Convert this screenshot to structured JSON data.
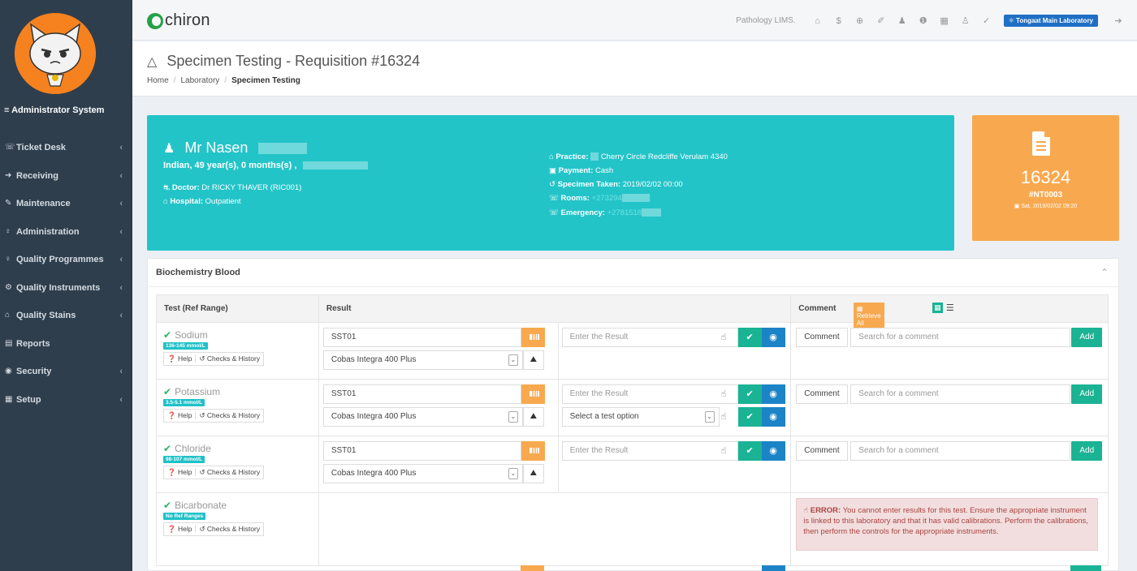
{
  "sidebar": {
    "system_name": "≡ Administrator System",
    "items": [
      {
        "label": "Ticket Desk",
        "icon": "☏",
        "name": "sidebar-item-ticket-desk",
        "icon_name": "phone-icon",
        "chev": true
      },
      {
        "label": "Receiving",
        "icon": "➔",
        "name": "sidebar-item-receiving",
        "icon_name": "arrow-right-icon",
        "chev": true
      },
      {
        "label": "Maintenance",
        "icon": "✎",
        "name": "sidebar-item-maintenance",
        "icon_name": "wrench-icon",
        "chev": true
      },
      {
        "label": "Administration",
        "icon": "♀",
        "name": "sidebar-item-administration",
        "icon_name": "pin-icon",
        "chev": true
      },
      {
        "label": "Quality Programmes",
        "icon": "♀",
        "name": "sidebar-item-quality-programmes",
        "icon_name": "award-icon",
        "chev": true
      },
      {
        "label": "Quality Instruments",
        "icon": "⚙",
        "name": "sidebar-item-quality-instruments",
        "icon_name": "gear-icon",
        "chev": true
      },
      {
        "label": "Quality Stains",
        "icon": "⌂",
        "name": "sidebar-item-quality-stains",
        "icon_name": "stain-icon",
        "chev": true
      },
      {
        "label": "Reports",
        "icon": "▤",
        "name": "sidebar-item-reports",
        "icon_name": "reports-icon",
        "chev": false
      },
      {
        "label": "Security",
        "icon": "◉",
        "name": "sidebar-item-security",
        "icon_name": "eye-icon",
        "chev": true
      },
      {
        "label": "Setup",
        "icon": "▦",
        "name": "sidebar-item-setup",
        "icon_name": "grid-icon",
        "chev": true
      }
    ],
    "chevron": "‹"
  },
  "topbar": {
    "logo_text": "chiron",
    "system_label": "Pathology LIMS.",
    "lab_label": "Tongaat Main Laboratory",
    "icons": [
      "⌂",
      "$",
      "⊕",
      "✐",
      "♟",
      "❶",
      "▦",
      "♙",
      "✓"
    ]
  },
  "page": {
    "title": "Specimen Testing - Requisition #16324",
    "breadcrumb": [
      "Home",
      "Laboratory",
      "Specimen Testing"
    ]
  },
  "patient": {
    "name": "Mr Nasen",
    "info": "Indian, 49 year(s), 0 months(s) ,",
    "doctor_label": "Doctor:",
    "doctor": "Dr RICKY THAVER (RIC001)",
    "hospital_label": "Hospital:",
    "hospital": "Outpatient",
    "practice_label": "Practice:",
    "practice": "Cherry Circle Redcliffe Verulam 4340",
    "payment_label": "Payment:",
    "payment": "Cash",
    "taken_label": "Specimen Taken:",
    "taken": "2019/02/02 00:00",
    "rooms_label": "Rooms:",
    "rooms": "+273294",
    "emergency_label": "Emergency:",
    "emergency": "+2781518"
  },
  "requisition": {
    "number": "16324",
    "code": "#NT0003",
    "date": "Sat, 2019/02/02 09:20"
  },
  "panel": {
    "title": "Biochemistry Blood",
    "headers": {
      "test": "Test (Ref Range)",
      "result": "Result",
      "comment": "Comment"
    },
    "retrieve_label": "Retrieve All Tubes",
    "help_label": "Help",
    "history_label": "Checks & History",
    "result_placeholder": "Enter the Result",
    "comment_label": "Comment",
    "comment_placeholder": "Search for a comment",
    "add_label": "Add",
    "tests": [
      {
        "name": "Sodium",
        "ref": "136-145 mmol/L",
        "tube": "SST01",
        "instrument": "Cobas Integra 400 Plus"
      },
      {
        "name": "Potassium",
        "ref": "3.5-5.1 mmol/L",
        "tube": "SST01",
        "instrument": "Cobas Integra 400 Plus",
        "option_placeholder": "Select a test option"
      },
      {
        "name": "Chloride",
        "ref": "98-107 mmol/L",
        "tube": "SST01",
        "instrument": "Cobas Integra 400 Plus"
      },
      {
        "name": "Bicarbonate",
        "ref": "No Ref Ranges"
      }
    ],
    "error_label": "ERROR:",
    "error_text": "You cannot enter results for this test. Ensure the appropriate instrument is linked to this laboratory and that it has valid calibrations. Perform the calibrations, then perform the controls for the appropriate instruments."
  }
}
